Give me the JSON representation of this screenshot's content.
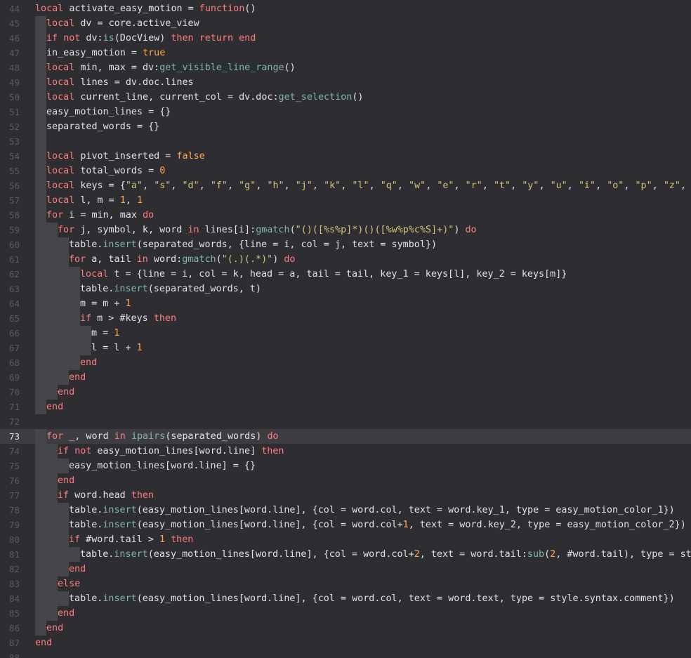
{
  "editor": {
    "theme": {
      "background": "#2e2e32",
      "current_line": "#3d3d41",
      "guide": "#45454a",
      "line_number": "#595962",
      "keyword": "#ff7d7d",
      "string": "#d3c37a",
      "number": "#ffa94d",
      "method": "#7fb8a6"
    },
    "current_line_number": 73,
    "lines": [
      {
        "n": "44",
        "indent": 0,
        "tokens": [
          [
            "k",
            "local"
          ],
          [
            "n",
            " activate_easy_motion = "
          ],
          [
            "k",
            "function"
          ],
          [
            "n",
            "()"
          ]
        ]
      },
      {
        "n": "45",
        "indent": 1,
        "tokens": [
          [
            "k",
            "local"
          ],
          [
            "n",
            " dv = core.active_view"
          ]
        ]
      },
      {
        "n": "46",
        "indent": 1,
        "tokens": [
          [
            "k",
            "if"
          ],
          [
            "n",
            " "
          ],
          [
            "k",
            "not"
          ],
          [
            "n",
            " dv:"
          ],
          [
            "m",
            "is"
          ],
          [
            "n",
            "(DocView) "
          ],
          [
            "k",
            "then"
          ],
          [
            "n",
            " "
          ],
          [
            "k",
            "return"
          ],
          [
            "n",
            " "
          ],
          [
            "k",
            "end"
          ]
        ]
      },
      {
        "n": "47",
        "indent": 1,
        "tokens": [
          [
            "n",
            "in_easy_motion = "
          ],
          [
            "l",
            "true"
          ]
        ]
      },
      {
        "n": "48",
        "indent": 1,
        "tokens": [
          [
            "k",
            "local"
          ],
          [
            "n",
            " min, max = dv:"
          ],
          [
            "m",
            "get_visible_line_range"
          ],
          [
            "n",
            "()"
          ]
        ]
      },
      {
        "n": "49",
        "indent": 1,
        "tokens": [
          [
            "k",
            "local"
          ],
          [
            "n",
            " lines = dv.doc.lines"
          ]
        ]
      },
      {
        "n": "50",
        "indent": 1,
        "tokens": [
          [
            "k",
            "local"
          ],
          [
            "n",
            " current_line, current_col = dv.doc:"
          ],
          [
            "m",
            "get_selection"
          ],
          [
            "n",
            "()"
          ]
        ]
      },
      {
        "n": "51",
        "indent": 1,
        "tokens": [
          [
            "n",
            "easy_motion_lines = {}"
          ]
        ]
      },
      {
        "n": "52",
        "indent": 1,
        "tokens": [
          [
            "n",
            "separated_words = {}"
          ]
        ]
      },
      {
        "n": "53",
        "indent": 1,
        "tokens": []
      },
      {
        "n": "54",
        "indent": 1,
        "tokens": [
          [
            "k",
            "local"
          ],
          [
            "n",
            " pivot_inserted = "
          ],
          [
            "l",
            "false"
          ]
        ]
      },
      {
        "n": "55",
        "indent": 1,
        "tokens": [
          [
            "k",
            "local"
          ],
          [
            "n",
            " total_words = "
          ],
          [
            "d",
            "0"
          ]
        ]
      },
      {
        "n": "56",
        "indent": 1,
        "tokens": [
          [
            "k",
            "local"
          ],
          [
            "n",
            " keys = {"
          ],
          [
            "s",
            "\"a\""
          ],
          [
            "n",
            ", "
          ],
          [
            "s",
            "\"s\""
          ],
          [
            "n",
            ", "
          ],
          [
            "s",
            "\"d\""
          ],
          [
            "n",
            ", "
          ],
          [
            "s",
            "\"f\""
          ],
          [
            "n",
            ", "
          ],
          [
            "s",
            "\"g\""
          ],
          [
            "n",
            ", "
          ],
          [
            "s",
            "\"h\""
          ],
          [
            "n",
            ", "
          ],
          [
            "s",
            "\"j\""
          ],
          [
            "n",
            ", "
          ],
          [
            "s",
            "\"k\""
          ],
          [
            "n",
            ", "
          ],
          [
            "s",
            "\"l\""
          ],
          [
            "n",
            ", "
          ],
          [
            "s",
            "\"q\""
          ],
          [
            "n",
            ", "
          ],
          [
            "s",
            "\"w\""
          ],
          [
            "n",
            ", "
          ],
          [
            "s",
            "\"e\""
          ],
          [
            "n",
            ", "
          ],
          [
            "s",
            "\"r\""
          ],
          [
            "n",
            ", "
          ],
          [
            "s",
            "\"t\""
          ],
          [
            "n",
            ", "
          ],
          [
            "s",
            "\"y\""
          ],
          [
            "n",
            ", "
          ],
          [
            "s",
            "\"u\""
          ],
          [
            "n",
            ", "
          ],
          [
            "s",
            "\"i\""
          ],
          [
            "n",
            ", "
          ],
          [
            "s",
            "\"o\""
          ],
          [
            "n",
            ", "
          ],
          [
            "s",
            "\"p\""
          ],
          [
            "n",
            ", "
          ],
          [
            "s",
            "\"z\""
          ],
          [
            "n",
            ", "
          ],
          [
            "s",
            "\""
          ]
        ]
      },
      {
        "n": "57",
        "indent": 1,
        "tokens": [
          [
            "k",
            "local"
          ],
          [
            "n",
            " l, m = "
          ],
          [
            "d",
            "1"
          ],
          [
            "n",
            ", "
          ],
          [
            "d",
            "1"
          ]
        ]
      },
      {
        "n": "58",
        "indent": 1,
        "tokens": [
          [
            "k",
            "for"
          ],
          [
            "n",
            " i = min, max "
          ],
          [
            "k",
            "do"
          ]
        ]
      },
      {
        "n": "59",
        "indent": 2,
        "tokens": [
          [
            "k",
            "for"
          ],
          [
            "n",
            " j, symbol, k, word "
          ],
          [
            "k",
            "in"
          ],
          [
            "n",
            " lines[i]:"
          ],
          [
            "m",
            "gmatch"
          ],
          [
            "n",
            "("
          ],
          [
            "s",
            "\"()([%s%p]*)()([%w%p%c%S]+)\""
          ],
          [
            "n",
            ") "
          ],
          [
            "k",
            "do"
          ]
        ]
      },
      {
        "n": "60",
        "indent": 3,
        "tokens": [
          [
            "n",
            "table."
          ],
          [
            "m",
            "insert"
          ],
          [
            "n",
            "(separated_words, {line = i, col = j, text = symbol})"
          ]
        ]
      },
      {
        "n": "61",
        "indent": 3,
        "tokens": [
          [
            "k",
            "for"
          ],
          [
            "n",
            " a, tail "
          ],
          [
            "k",
            "in"
          ],
          [
            "n",
            " word:"
          ],
          [
            "m",
            "gmatch"
          ],
          [
            "n",
            "("
          ],
          [
            "s",
            "\"(.)(.*)\""
          ],
          [
            "n",
            ") "
          ],
          [
            "k",
            "do"
          ]
        ]
      },
      {
        "n": "62",
        "indent": 4,
        "tokens": [
          [
            "k",
            "local"
          ],
          [
            "n",
            " t = {line = i, col = k, head = a, tail = tail, key_1 = keys[l], key_2 = keys[m]}"
          ]
        ]
      },
      {
        "n": "63",
        "indent": 4,
        "tokens": [
          [
            "n",
            "table."
          ],
          [
            "m",
            "insert"
          ],
          [
            "n",
            "(separated_words, t)"
          ]
        ]
      },
      {
        "n": "64",
        "indent": 4,
        "tokens": [
          [
            "n",
            "m = m + "
          ],
          [
            "d",
            "1"
          ]
        ]
      },
      {
        "n": "65",
        "indent": 4,
        "tokens": [
          [
            "k",
            "if"
          ],
          [
            "n",
            " m > #keys "
          ],
          [
            "k",
            "then"
          ]
        ]
      },
      {
        "n": "66",
        "indent": 5,
        "tokens": [
          [
            "n",
            "m = "
          ],
          [
            "d",
            "1"
          ]
        ]
      },
      {
        "n": "67",
        "indent": 5,
        "tokens": [
          [
            "n",
            "l = l + "
          ],
          [
            "d",
            "1"
          ]
        ]
      },
      {
        "n": "68",
        "indent": 4,
        "tokens": [
          [
            "k",
            "end"
          ]
        ]
      },
      {
        "n": "69",
        "indent": 3,
        "tokens": [
          [
            "k",
            "end"
          ]
        ]
      },
      {
        "n": "70",
        "indent": 2,
        "tokens": [
          [
            "k",
            "end"
          ]
        ]
      },
      {
        "n": "71",
        "indent": 1,
        "tokens": [
          [
            "k",
            "end"
          ]
        ]
      },
      {
        "n": "72",
        "indent": 0,
        "tokens": []
      },
      {
        "n": "73",
        "indent": 1,
        "tokens": [
          [
            "k",
            "for"
          ],
          [
            "n",
            " _, word "
          ],
          [
            "k",
            "in"
          ],
          [
            "n",
            " "
          ],
          [
            "m",
            "ipairs"
          ],
          [
            "n",
            "(separated_words) "
          ],
          [
            "k",
            "do"
          ]
        ]
      },
      {
        "n": "74",
        "indent": 2,
        "tokens": [
          [
            "k",
            "if"
          ],
          [
            "n",
            " "
          ],
          [
            "k",
            "not"
          ],
          [
            "n",
            " easy_motion_lines[word.line] "
          ],
          [
            "k",
            "then"
          ]
        ]
      },
      {
        "n": "75",
        "indent": 3,
        "tokens": [
          [
            "n",
            "easy_motion_lines[word.line] = {}"
          ]
        ]
      },
      {
        "n": "76",
        "indent": 2,
        "tokens": [
          [
            "k",
            "end"
          ]
        ]
      },
      {
        "n": "77",
        "indent": 2,
        "tokens": [
          [
            "k",
            "if"
          ],
          [
            "n",
            " word.head "
          ],
          [
            "k",
            "then"
          ]
        ]
      },
      {
        "n": "78",
        "indent": 3,
        "tokens": [
          [
            "n",
            "table."
          ],
          [
            "m",
            "insert"
          ],
          [
            "n",
            "(easy_motion_lines[word.line], {col = word.col, text = word.key_1, type = easy_motion_color_1})"
          ]
        ]
      },
      {
        "n": "79",
        "indent": 3,
        "tokens": [
          [
            "n",
            "table."
          ],
          [
            "m",
            "insert"
          ],
          [
            "n",
            "(easy_motion_lines[word.line], {col = word.col+"
          ],
          [
            "d",
            "1"
          ],
          [
            "n",
            ", text = word.key_2, type = easy_motion_color_2})"
          ]
        ]
      },
      {
        "n": "80",
        "indent": 3,
        "tokens": [
          [
            "k",
            "if"
          ],
          [
            "n",
            " #word.tail > "
          ],
          [
            "d",
            "1"
          ],
          [
            "n",
            " "
          ],
          [
            "k",
            "then"
          ]
        ]
      },
      {
        "n": "81",
        "indent": 4,
        "tokens": [
          [
            "n",
            "table."
          ],
          [
            "m",
            "insert"
          ],
          [
            "n",
            "(easy_motion_lines[word.line], {col = word.col+"
          ],
          [
            "d",
            "2"
          ],
          [
            "n",
            ", text = word.tail:"
          ],
          [
            "m",
            "sub"
          ],
          [
            "n",
            "("
          ],
          [
            "d",
            "2"
          ],
          [
            "n",
            ", #word.tail), type = sty"
          ]
        ]
      },
      {
        "n": "82",
        "indent": 3,
        "tokens": [
          [
            "k",
            "end"
          ]
        ]
      },
      {
        "n": "83",
        "indent": 2,
        "tokens": [
          [
            "k",
            "else"
          ]
        ]
      },
      {
        "n": "84",
        "indent": 3,
        "tokens": [
          [
            "n",
            "table."
          ],
          [
            "m",
            "insert"
          ],
          [
            "n",
            "(easy_motion_lines[word.line], {col = word.col, text = word.text, type = style.syntax.comment})"
          ]
        ]
      },
      {
        "n": "85",
        "indent": 2,
        "tokens": [
          [
            "k",
            "end"
          ]
        ]
      },
      {
        "n": "86",
        "indent": 1,
        "tokens": [
          [
            "k",
            "end"
          ]
        ]
      },
      {
        "n": "87",
        "indent": 0,
        "tokens": [
          [
            "k",
            "end"
          ]
        ]
      },
      {
        "n": "88",
        "indent": 0,
        "tokens": []
      }
    ]
  }
}
